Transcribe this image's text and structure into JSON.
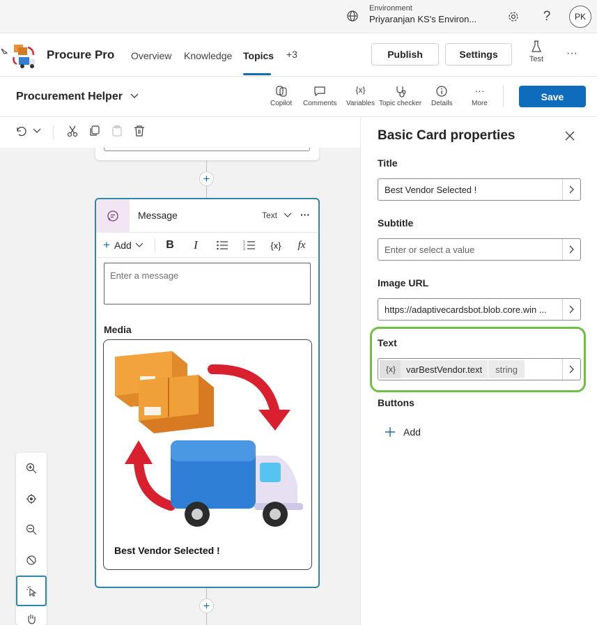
{
  "topbar": {
    "env_label": "Environment",
    "env_value": "Priyaranjan KS's Environ...",
    "avatar": "PK"
  },
  "app": {
    "name": "Procure Pro",
    "tabs": [
      {
        "label": "Overview",
        "active": false
      },
      {
        "label": "Knowledge",
        "active": false
      },
      {
        "label": "Topics",
        "active": true
      },
      {
        "label": "+3",
        "active": false
      }
    ],
    "publish": "Publish",
    "settings": "Settings",
    "test": "Test"
  },
  "topic": {
    "name": "Procurement Helper",
    "tools": {
      "copilot": "Copilot",
      "comments": "Comments",
      "variables": "Variables",
      "topic_checker": "Topic checker",
      "details": "Details",
      "more": "More"
    },
    "save": "Save"
  },
  "message_node": {
    "title": "Message",
    "type": "Text",
    "add_label": "Add",
    "message_placeholder": "Enter a message",
    "media_label": "Media",
    "card_title": "Best Vendor Selected !"
  },
  "properties": {
    "header": "Basic Card properties",
    "title_label": "Title",
    "title_value": "Best Vendor Selected !",
    "subtitle_label": "Subtitle",
    "subtitle_placeholder": "Enter or select a value",
    "image_label": "Image URL",
    "image_value": "https://adaptivecardsbot.blob.core.win ...",
    "text_label": "Text",
    "text_var_icon": "{x}",
    "text_var": "varBestVendor.text",
    "text_var_type": "string",
    "buttons_label": "Buttons",
    "add_button": "Add"
  },
  "colors": {
    "accent": "#0f6cbd",
    "node_border": "#2b88a8",
    "highlight": "#70bf44"
  }
}
